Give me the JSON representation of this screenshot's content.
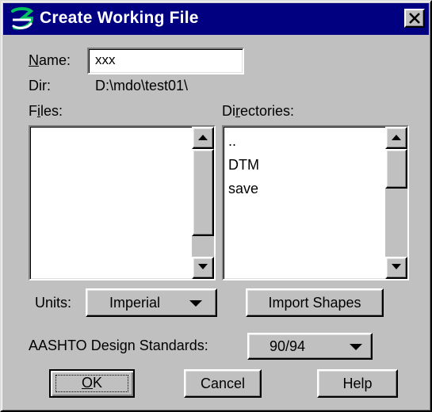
{
  "window": {
    "title": "Create Working File",
    "close_symbol": "✕",
    "icon": "app-logo-icon"
  },
  "name": {
    "label": "Name:",
    "accesskey": "N",
    "rest": "ame:",
    "value": "xxx"
  },
  "dir": {
    "label": "Dir:",
    "value": "D:\\mdo\\test01\\"
  },
  "files": {
    "label_pre": "F",
    "label_key": "i",
    "label_post": "les:",
    "items": []
  },
  "directories": {
    "label_pre": "Di",
    "label_key": "r",
    "label_post": "ectories:",
    "items": [
      "..",
      "DTM",
      "save"
    ]
  },
  "units": {
    "label": "Units:",
    "value": "Imperial"
  },
  "import_shapes": {
    "label": "Import Shapes"
  },
  "aashto": {
    "label": "AASHTO Design Standards:",
    "value": "90/94"
  },
  "buttons": {
    "ok": {
      "key": "O",
      "rest": "K"
    },
    "cancel": "Cancel",
    "help": "Help"
  },
  "colors": {
    "titlebar": "#000080",
    "face": "#c0c0c0",
    "field": "#ffffff"
  }
}
